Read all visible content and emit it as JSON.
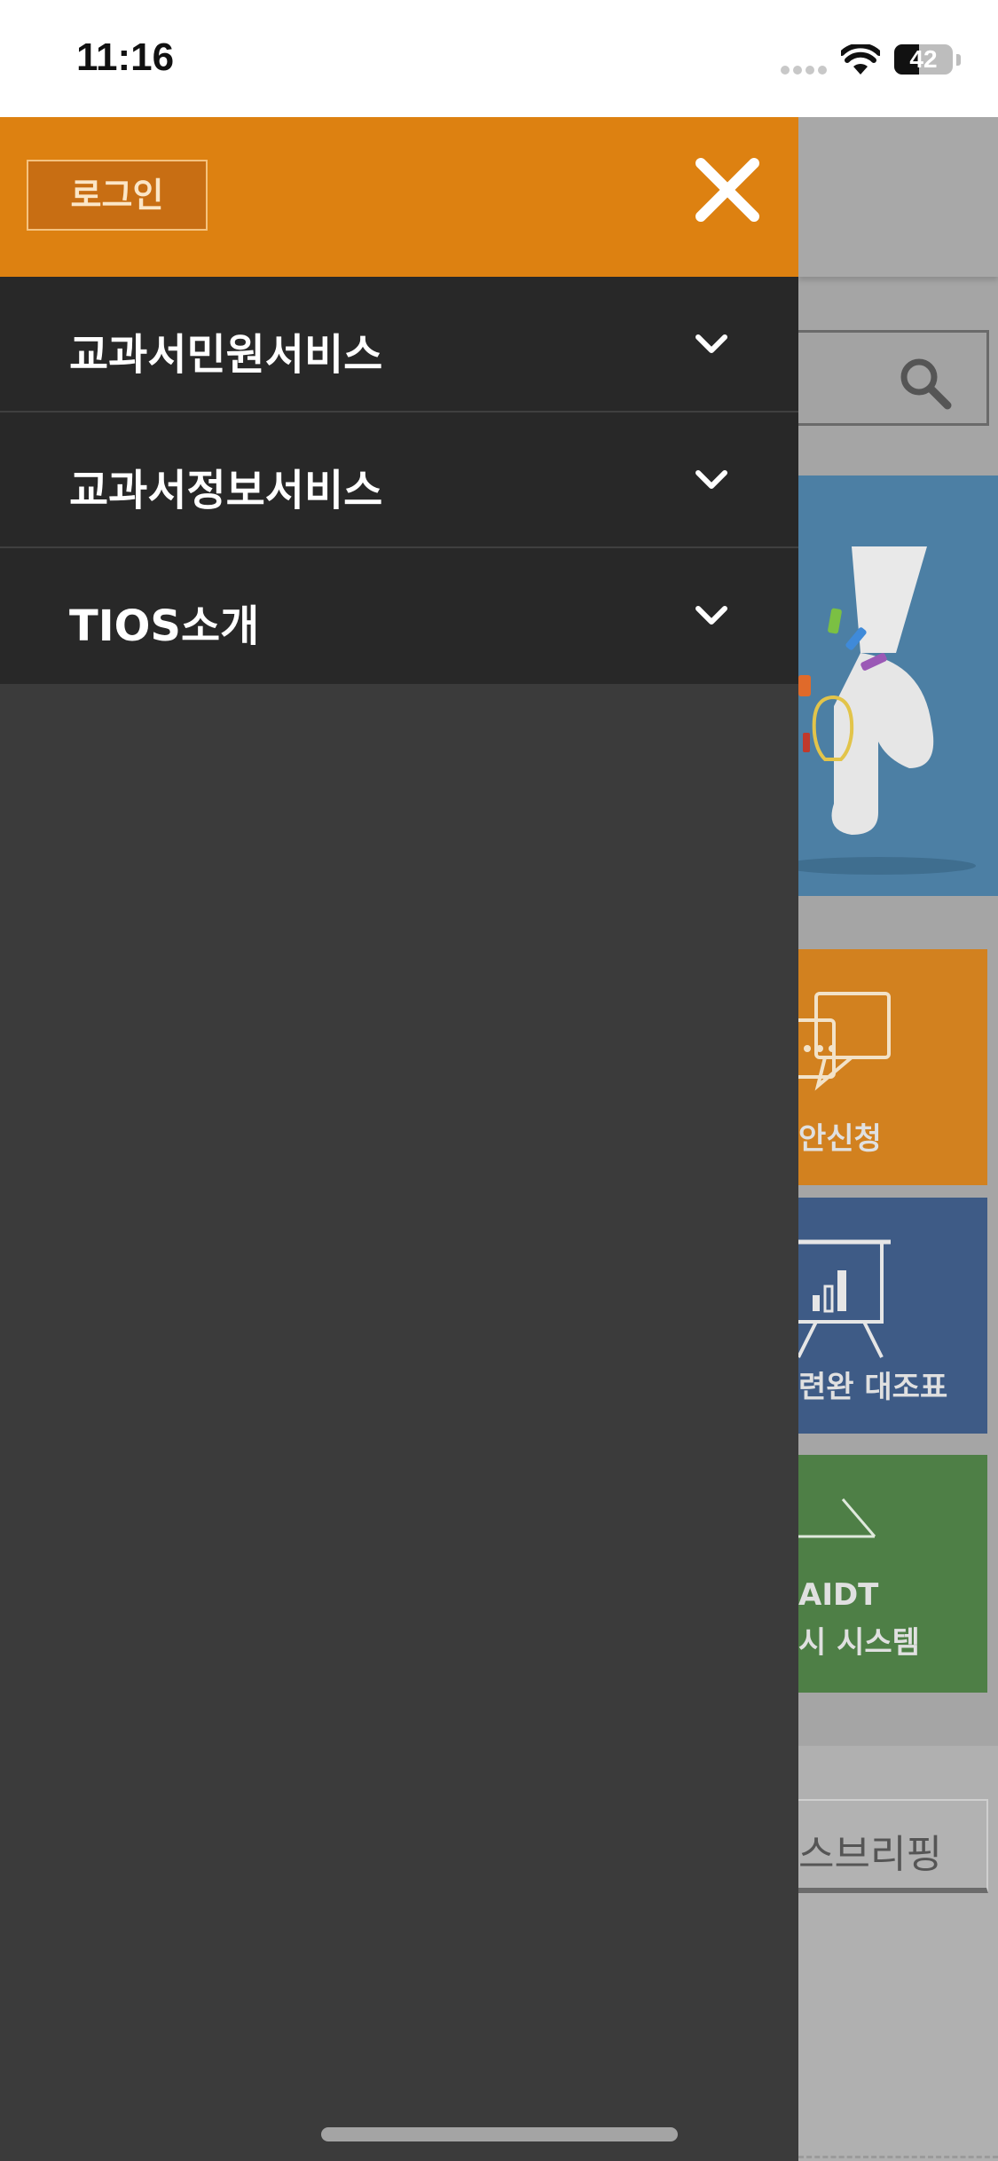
{
  "status_bar": {
    "time": "11:16",
    "battery_level": "42",
    "battery_fraction": 0.42
  },
  "drawer": {
    "login_label": "로그인",
    "close_icon": "close-icon",
    "accent_color": "#dd8111",
    "menu_items": [
      {
        "label": "교과서민원서비스",
        "icon": "chevron-down-icon"
      },
      {
        "label": "교과서정보서비스",
        "icon": "chevron-down-icon"
      },
      {
        "label": "TIOS소개",
        "icon": "chevron-down-icon"
      }
    ]
  },
  "background_page": {
    "search_icon": "search-icon",
    "tiles": [
      {
        "label_lines": [
          "안신청"
        ],
        "color": "#d2811f",
        "icon": "chat-bubbles-icon"
      },
      {
        "label_lines": [
          "련완 대조표"
        ],
        "color": "#3e5b86",
        "icon": "presentation-board-icon"
      },
      {
        "label_lines": [
          "AIDT",
          "시 시스템"
        ],
        "color": "#4e7f46",
        "icon": "device-icon"
      }
    ],
    "tab_label": "스브리핑"
  }
}
